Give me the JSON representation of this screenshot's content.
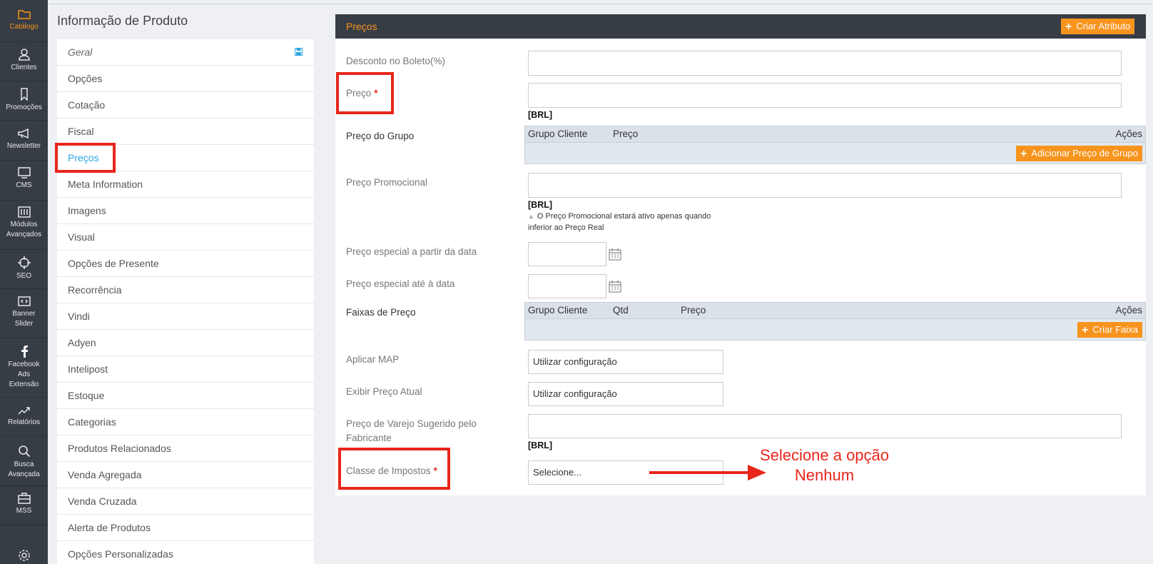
{
  "nav": {
    "items": [
      {
        "label": "Catálogo",
        "icon": "folder-icon",
        "active": true
      },
      {
        "label": "Clientes",
        "icon": "user-icon"
      },
      {
        "label": "Promoções",
        "icon": "tag-icon"
      },
      {
        "label": "Newsletter",
        "icon": "megaphone-icon"
      },
      {
        "label": "CMS",
        "icon": "monitor-icon"
      },
      {
        "label": "Módulos\nAvançados",
        "icon": "sliders-icon"
      },
      {
        "label": "SEO",
        "icon": "target-icon"
      },
      {
        "label": "Banner\nSlider",
        "icon": "code-icon"
      },
      {
        "label": "Facebook\nAds\nExtensão",
        "icon": "facebook-icon"
      },
      {
        "label": "Relatórios",
        "icon": "chart-icon"
      },
      {
        "label": "Busca\nAvançada",
        "icon": "search-icon"
      },
      {
        "label": "MSS",
        "icon": "briefcase-icon"
      },
      {
        "label": "",
        "icon": "gear-icon"
      }
    ]
  },
  "page_title": "Informação de Produto",
  "tabs": {
    "items": [
      "Geral",
      "Opções",
      "Cotação",
      "Fiscal",
      "Preços",
      "Meta Information",
      "Imagens",
      "Visual",
      "Opções de Presente",
      "Recorrência",
      "Vindi",
      "Adyen",
      "Intelipost",
      "Estoque",
      "Categorias",
      "Produtos Relacionados",
      "Venda Agregada",
      "Venda Cruzada",
      "Alerta de Produtos",
      "Opções Personalizadas"
    ],
    "active": "Preços"
  },
  "panel": {
    "title": "Preços",
    "create_attribute": "Criar Atributo"
  },
  "form": {
    "desconto_label": "Desconto no Boleto(%)",
    "preco_label": "Preço",
    "required_mark": "*",
    "currency": "[BRL]",
    "grupo_label": "Preço do Grupo",
    "grupo_cols": {
      "cliente": "Grupo Cliente",
      "preco": "Preço",
      "acoes": "Ações"
    },
    "grupo_add": "Adicionar Preço de Grupo",
    "promo_label": "Preço Promocional",
    "promo_hint": "O Preço Promocional estará ativo apenas quando\ninferior ao Preço Real",
    "from_date_label": "Preço especial a partir da data",
    "to_date_label": "Preço especial até à data",
    "faixas_label": "Faixas de Preço",
    "faixas_cols": {
      "cliente": "Grupo Cliente",
      "qtd": "Qtd",
      "preco": "Preço",
      "acoes": "Ações"
    },
    "faixas_add": "Criar Faixa",
    "map_label": "Aplicar MAP",
    "map_value": "Utilizar configuração",
    "exibir_label": "Exibir Preço Atual",
    "exibir_value": "Utilizar configuração",
    "varejo_label": "Preço de Varejo Sugerido pelo\nFabricante",
    "impostos_label": "Classe de Impostos",
    "impostos_value": "Selecione..."
  },
  "annotation": {
    "text": "Selecione a opção\nNenhum",
    "color": "#e8261c"
  },
  "colors": {
    "accent": "#f7941d",
    "nav_bg": "#373d45",
    "link": "#2aa6e0"
  }
}
